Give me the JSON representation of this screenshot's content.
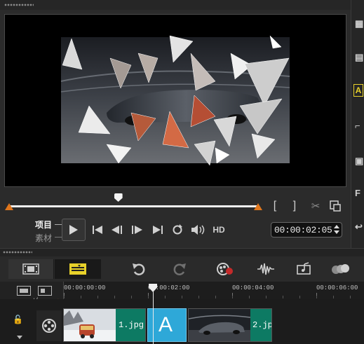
{
  "player": {
    "mode_project": "项目",
    "mode_clip": "素材",
    "hd_label": "HD",
    "timecode": "00:00:02:05",
    "scrub_position": 0.44
  },
  "playback_icons": {
    "play": "play-icon",
    "home": "skip-to-start-icon",
    "prev": "previous-frame-icon",
    "next": "next-frame-icon",
    "end": "skip-to-end-icon",
    "repeat": "repeat-icon",
    "volume": "volume-icon"
  },
  "toolbar": {
    "items": [
      "storyboard-view-icon",
      "timeline-view-icon",
      "undo-icon",
      "redo-icon",
      "record-capture-icon",
      "audio-mixer-icon",
      "auto-music-icon",
      "motion-tracking-icon"
    ]
  },
  "timeline": {
    "ticks": [
      "00:00:00:00",
      "00:00:02:00",
      "00:00:04:00",
      "00:00:06:00"
    ],
    "zoom_label": "+/−",
    "playhead_time_fraction": 0.35
  },
  "clips": [
    {
      "label": "1.jpg",
      "kind": "photo"
    },
    {
      "label": "A",
      "kind": "title-transition"
    },
    {
      "label": "2.jpg",
      "kind": "photo"
    }
  ],
  "colors": {
    "accent_orange": "#e0761c",
    "clip_teal": "#0d7a63",
    "transition_blue": "#2ea8d8",
    "toolbar_active": "#e8d12a"
  }
}
